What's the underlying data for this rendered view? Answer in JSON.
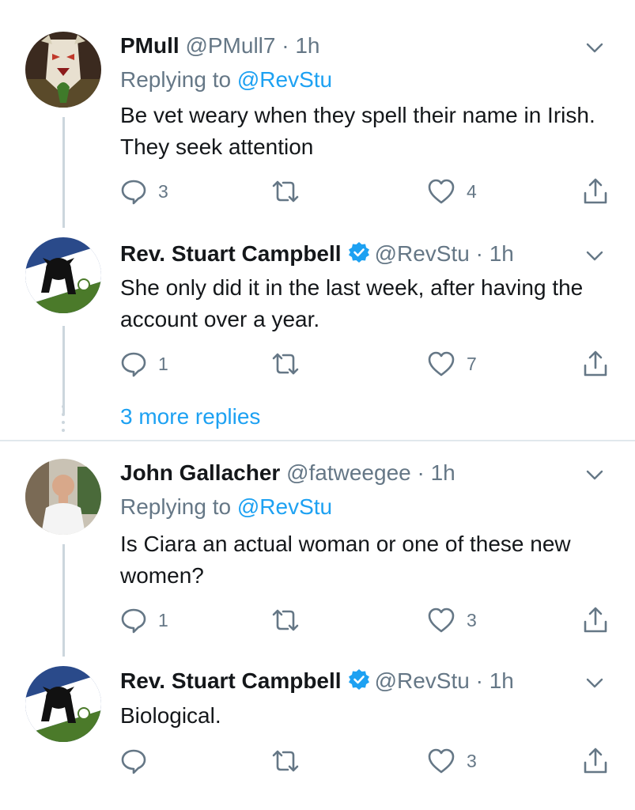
{
  "tweets": [
    {
      "name": "PMull",
      "handle": "@PMull7",
      "time": "· 1h",
      "verified": false,
      "replying_prefix": "Replying to",
      "replying_to": "@RevStu",
      "text": "Be vet weary when they spell their name in Irish. They seek attention",
      "replies": "3",
      "retweets": "",
      "likes": "4"
    },
    {
      "name": "Rev. Stuart Campbell",
      "handle": "@RevStu",
      "time": "· 1h",
      "verified": true,
      "text": "She only did it in the last week, after having the account over a year.",
      "replies": "1",
      "retweets": "",
      "likes": "7"
    },
    {
      "name": "John Gallacher",
      "handle": "@fatweegee",
      "time": "· 1h",
      "verified": false,
      "replying_prefix": "Replying to",
      "replying_to": "@RevStu",
      "text": "Is Ciara an actual woman or one of these new women?",
      "replies": "1",
      "retweets": "",
      "likes": "3"
    },
    {
      "name": "Rev. Stuart Campbell",
      "handle": "@RevStu",
      "time": "· 1h",
      "verified": true,
      "text": "Biological.",
      "replies": "",
      "retweets": "",
      "likes": "3"
    }
  ],
  "more_replies": "3 more replies",
  "colors": {
    "accent": "#1da1f2",
    "secondary_text": "#657786",
    "primary_text": "#14171a",
    "thread_line": "#ccd6dd"
  },
  "icons": [
    "reply-icon",
    "retweet-icon",
    "like-icon",
    "share-icon",
    "chevron-down-icon",
    "verified-badge-icon"
  ]
}
